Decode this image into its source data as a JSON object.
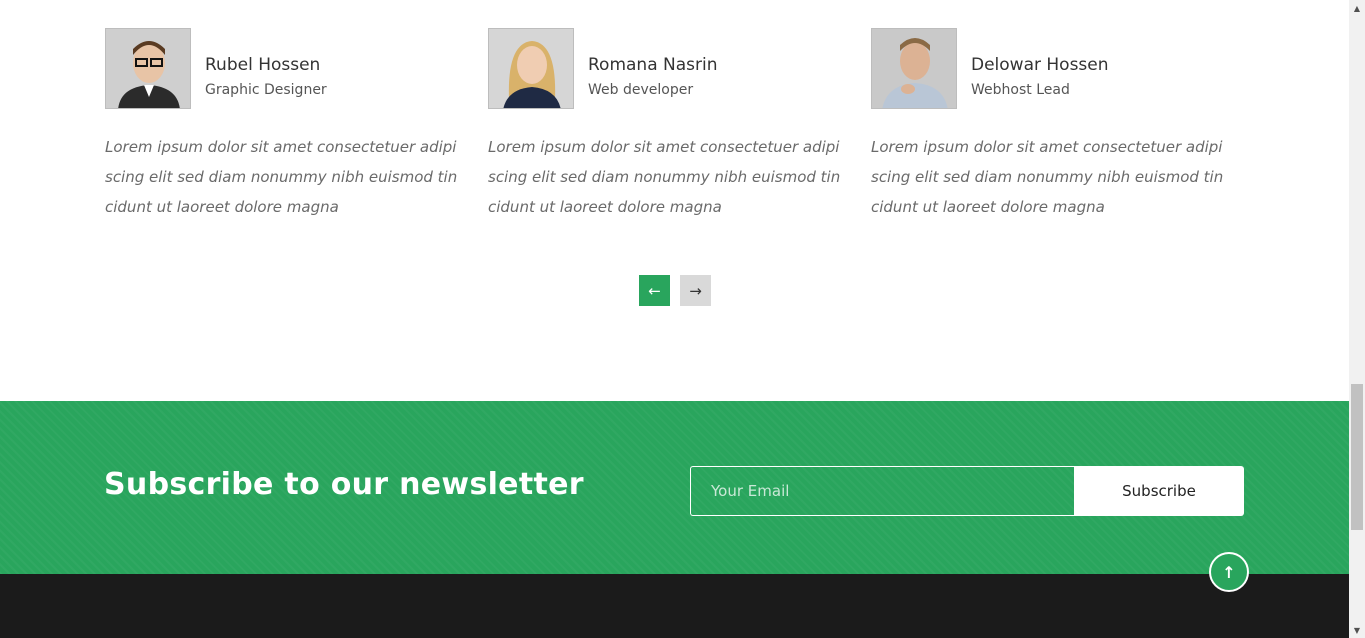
{
  "team": {
    "members": [
      {
        "name": "Rubel Hossen",
        "role": "Graphic Designer",
        "quote": "Lorem ipsum dolor sit amet consectetuer adipiscing elit sed diam nonummy nibh euismod tincidunt ut laoreet dolore magna",
        "photo_icon": "person-photo-icon"
      },
      {
        "name": "Romana Nasrin",
        "role": "Web developer",
        "quote": "Lorem ipsum dolor sit amet consectetuer adipiscing elit sed diam nonummy nibh euismod tincidunt ut laoreet dolore magna",
        "photo_icon": "person-photo-icon"
      },
      {
        "name": "Delowar Hossen",
        "role": "Webhost Lead",
        "quote": "Lorem ipsum dolor sit amet consectetuer adipiscing elit sed diam nonummy nibh euismod tincidunt ut laoreet dolore magna",
        "photo_icon": "person-photo-icon"
      }
    ],
    "prev_label": "←",
    "next_label": "→"
  },
  "newsletter": {
    "title": "Subscribe to our newsletter",
    "email_placeholder": "Your Email",
    "subscribe_label": "Subscribe"
  },
  "scroll_top_label": "↑",
  "colors": {
    "accent": "#29a55d",
    "footer": "#1b1b1b"
  }
}
